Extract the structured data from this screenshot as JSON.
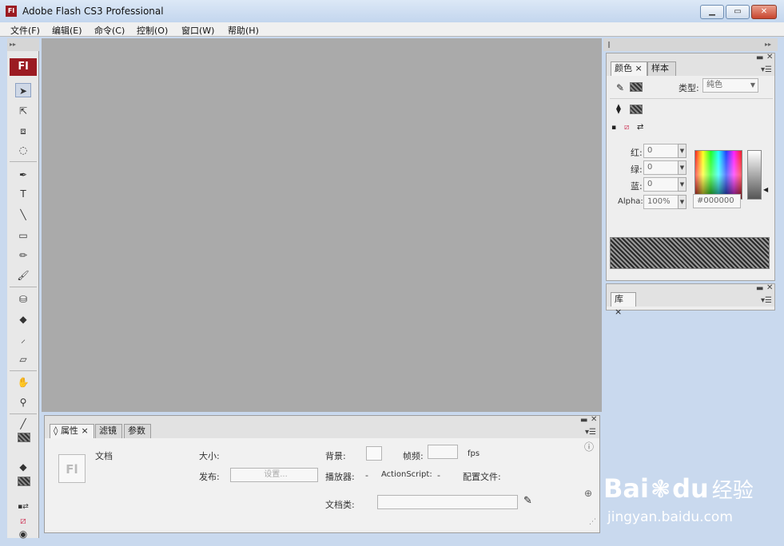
{
  "window": {
    "title": "Adobe Flash CS3 Professional",
    "app_icon": "Fl",
    "minimize_icon": "minimize-icon",
    "maximize_icon": "maximize-icon",
    "close_icon": "close-icon"
  },
  "menu": [
    "文件(F)",
    "编辑(E)",
    "命令(C)",
    "控制(O)",
    "窗口(W)",
    "帮助(H)"
  ],
  "tools": {
    "logo": "Fl",
    "panel_collapse": "▸▸"
  },
  "color_panel": {
    "tabs": [
      "颜色",
      "样本"
    ],
    "type_label": "类型:",
    "type_value": "纯色",
    "red_label": "红:",
    "red_value": "0",
    "green_label": "绿:",
    "green_value": "0",
    "blue_label": "蓝:",
    "blue_value": "0",
    "alpha_label": "Alpha:",
    "alpha_value": "100%",
    "hex_value": "#000000"
  },
  "library_panel": {
    "tabs": [
      "库"
    ]
  },
  "properties_panel": {
    "tabs": [
      "属性",
      "滤镜",
      "参数"
    ],
    "doc_label": "文档",
    "doc_icon_text": "Fl",
    "size_label": "大小:",
    "publish_label": "发布:",
    "settings_button": "设置...",
    "background_label": "背景:",
    "framerate_label": "帧频:",
    "framerate_value": "",
    "fps_label": "fps",
    "player_label": "播放器:",
    "player_value": "-",
    "actionscript_label": "ActionScript:",
    "actionscript_value": "-",
    "profile_label": "配置文件:",
    "doc_class_label": "文档类:",
    "doc_class_value": ""
  },
  "watermark": {
    "brand_prefix": "Bai",
    "brand_suffix": "du",
    "brand_cn": "经验",
    "url": "jingyan.baidu.com"
  }
}
